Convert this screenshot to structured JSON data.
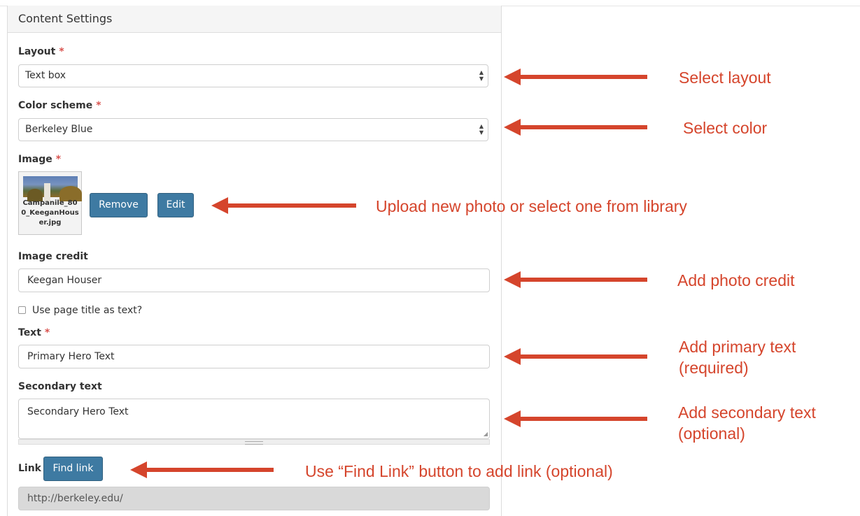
{
  "panel": {
    "title": "Content Settings"
  },
  "required_marker": "*",
  "layout": {
    "label": "Layout",
    "value": "Text box"
  },
  "color_scheme": {
    "label": "Color scheme",
    "value": "Berkeley Blue"
  },
  "image": {
    "label": "Image",
    "filename": "Campanile_800_KeeganHouser.jpg",
    "remove_label": "Remove",
    "edit_label": "Edit"
  },
  "image_credit": {
    "label": "Image credit",
    "value": "Keegan Houser"
  },
  "use_title": {
    "label": "Use page title as text?",
    "checked": false
  },
  "text": {
    "label": "Text",
    "value": "Primary Hero Text"
  },
  "secondary_text": {
    "label": "Secondary text",
    "value": "Secondary Hero Text"
  },
  "link": {
    "label": "Link",
    "button_label": "Find link",
    "value": "http://berkeley.edu/"
  },
  "annotations": {
    "layout": "Select layout",
    "color": "Select color",
    "image": "Upload new photo or select one from library",
    "credit": "Add photo credit",
    "primary_line1": "Add primary text",
    "primary_line2": "(required)",
    "secondary_line1": "Add secondary text",
    "secondary_line2": "(optional)",
    "link": "Use “Find Link” button to add link (optional)"
  },
  "colors": {
    "annotation": "#d5452c",
    "button": "#3e7aa2",
    "required": "#d9534f"
  },
  "icons": [
    "select-arrows-icon",
    "arrow-left-icon",
    "textarea-resize-icon"
  ]
}
